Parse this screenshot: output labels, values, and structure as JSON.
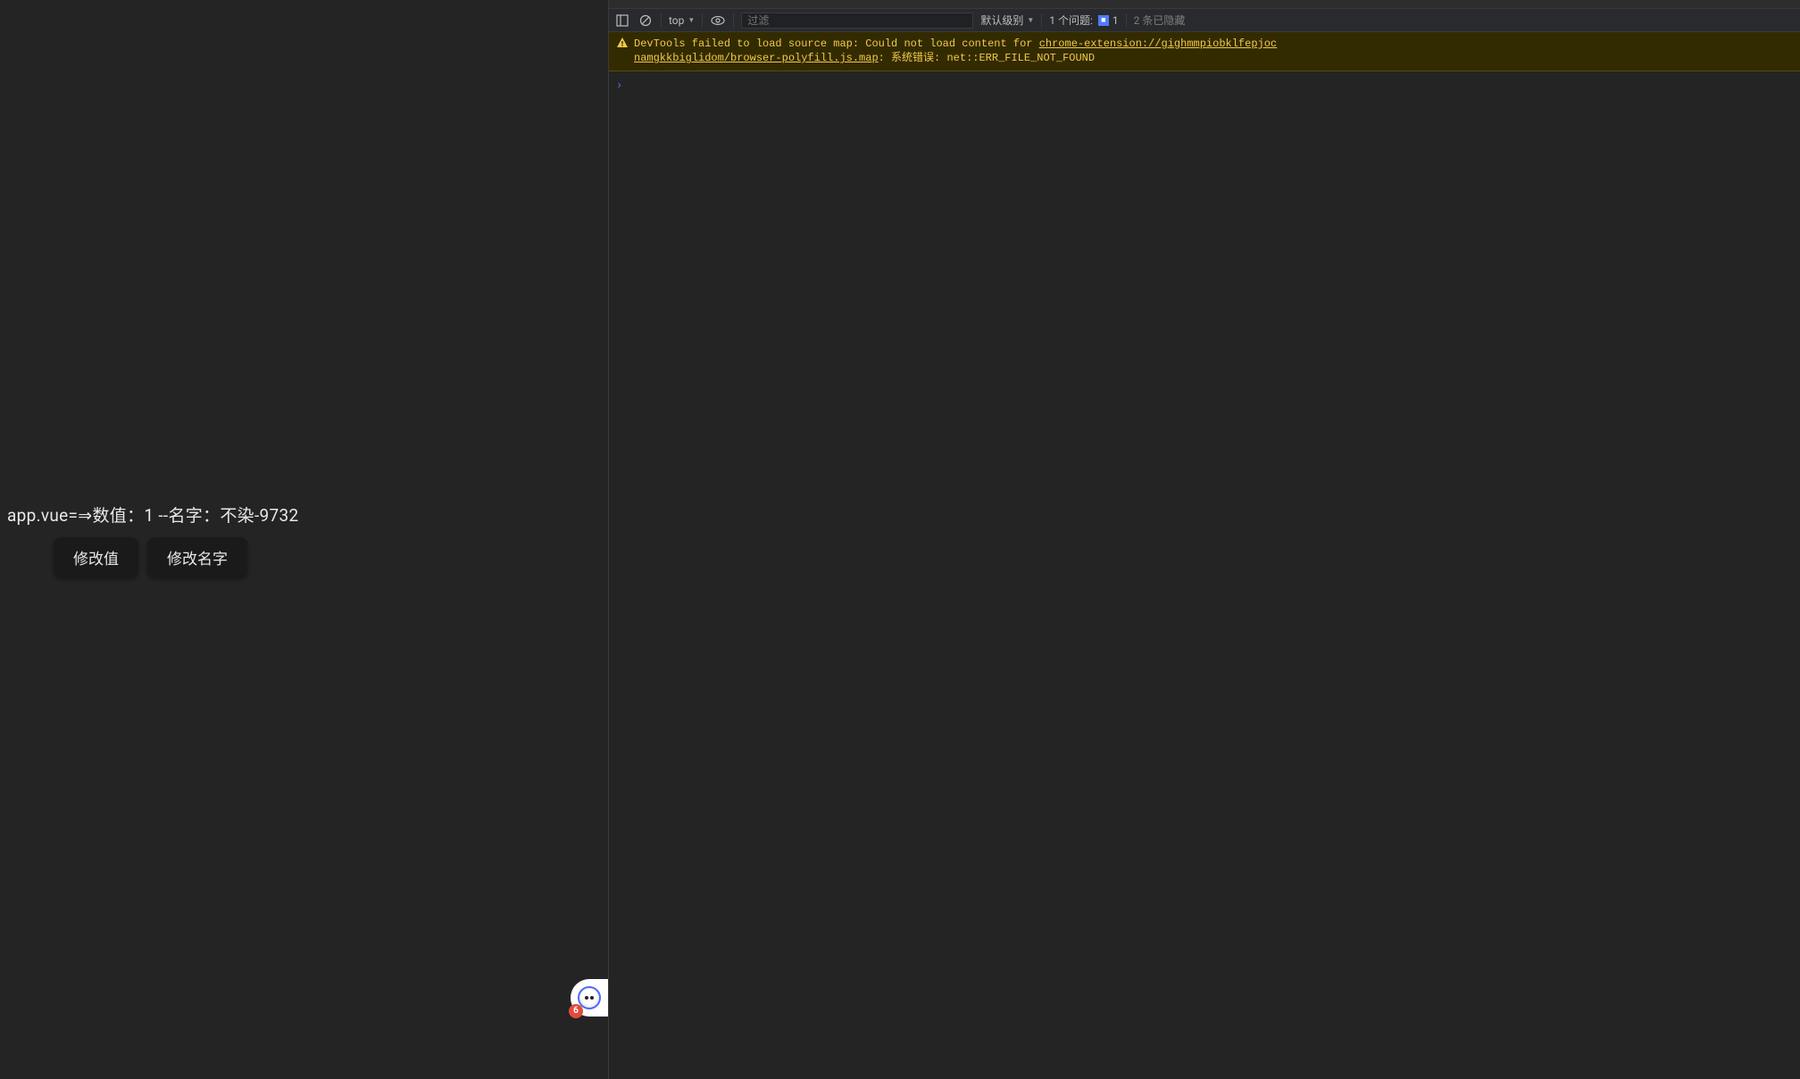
{
  "page": {
    "text_line": "app.vue=⇒数值：1 --名字：不染-9732",
    "buttons": {
      "modify_value": "修改值",
      "modify_name": "修改名字"
    },
    "widget_badge": "6"
  },
  "devtools": {
    "toolbar": {
      "context": "top",
      "filter_placeholder": "过滤",
      "level_label": "默认级别",
      "issues_label": "1 个问题:",
      "issues_count": "1",
      "hidden_label": "2 条已隐藏"
    },
    "warning": {
      "prefix": "DevTools failed to load source map: Could not load content for ",
      "url_line1": "chrome-extension://gighmmpiobklfepjoc",
      "url_line2": "namgkkbiglidom/browser-polyfill.js.map",
      "suffix": ":  系统错误: net::ERR_FILE_NOT_FOUND"
    },
    "prompt": "›"
  }
}
